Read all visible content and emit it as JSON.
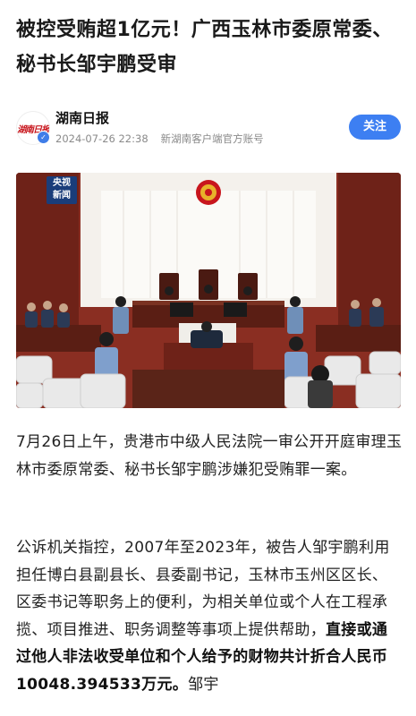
{
  "article": {
    "title": "被控受贿超1亿元！广西玉林市委原常委、秘书长邹宇鹏受审"
  },
  "author": {
    "name": "湖南日报",
    "avatar_text": "湖南日报",
    "date": "2024-07-26 22:38",
    "source": "新湖南客户端官方账号",
    "follow_label": "关注"
  },
  "photo": {
    "badge_line1": "央视",
    "badge_line2": "新闻"
  },
  "body": {
    "para1": "7月26日上午，贵港市中级人民法院一审公开开庭审理玉林市委原常委、秘书长邹宇鹏涉嫌犯受贿罪一案。",
    "para2_normal": "公诉机关指控，2007年至2023年，被告人邹宇鹏利用担任博白县副县长、县委副书记，玉林市玉州区区长、区委书记等职务上的便利，为相关单位或个人在工程承揽、项目推进、职务调整等事项上提供帮助，",
    "para2_bold": "直接或通过他人非法收受单位和个人给予的财物共计折合人民币10048.394533万元。",
    "para2_tail": "邹宇"
  },
  "colors": {
    "follow_button": "#3d7ff2",
    "meta_text": "#8a8a8a",
    "badge_bg": "#1a3d7a"
  }
}
